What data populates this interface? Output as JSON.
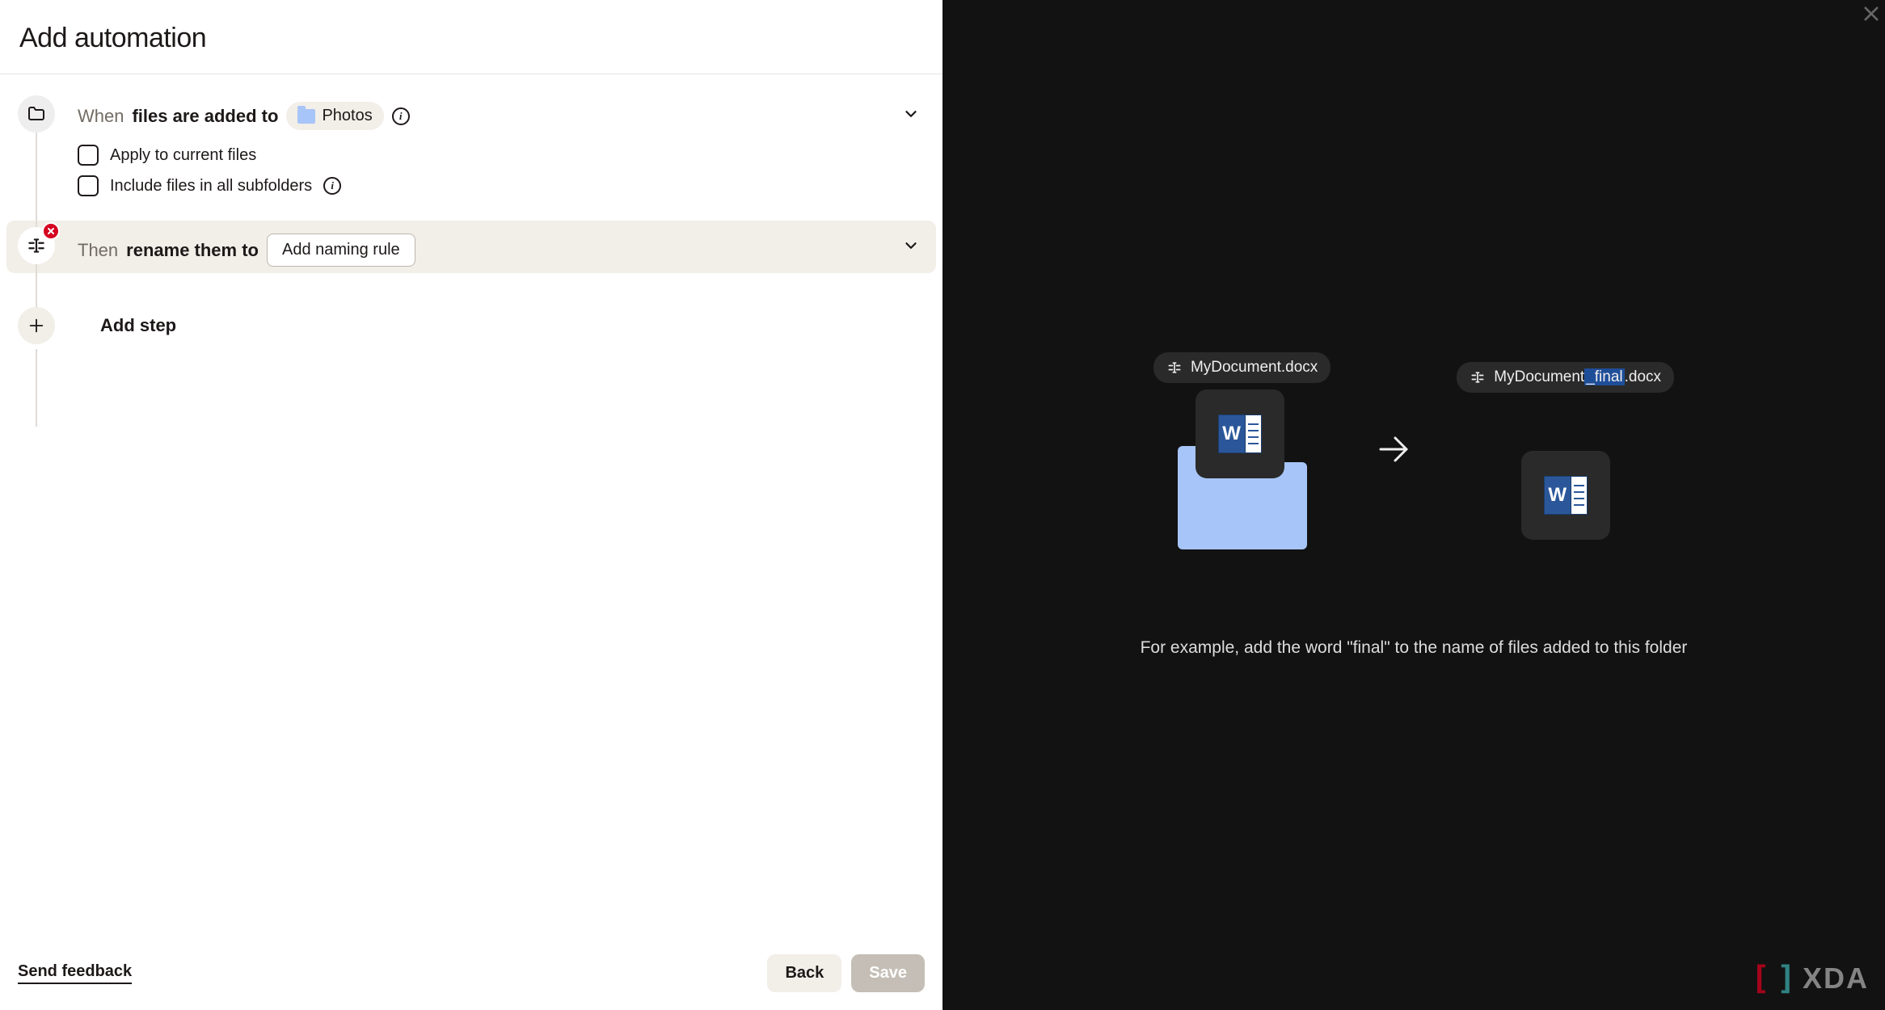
{
  "header": {
    "title": "Add automation"
  },
  "when": {
    "prefix": "When",
    "bold": "files are added to",
    "folder": "Photos",
    "options": {
      "apply_current": "Apply to current files",
      "include_subfolders": "Include files in all subfolders"
    }
  },
  "then": {
    "prefix": "Then",
    "bold": "rename them to",
    "rule_button": "Add naming rule"
  },
  "add_step": {
    "label": "Add step"
  },
  "footer": {
    "feedback": "Send feedback",
    "back": "Back",
    "save": "Save"
  },
  "preview": {
    "before_name": "MyDocument.docx",
    "after_pre": "MyDocument",
    "after_highlight": "_final",
    "after_post": ".docx",
    "example": "For example, add the word \"final\" to the name of files added to this folder"
  },
  "branding": {
    "xda": "XDA"
  }
}
